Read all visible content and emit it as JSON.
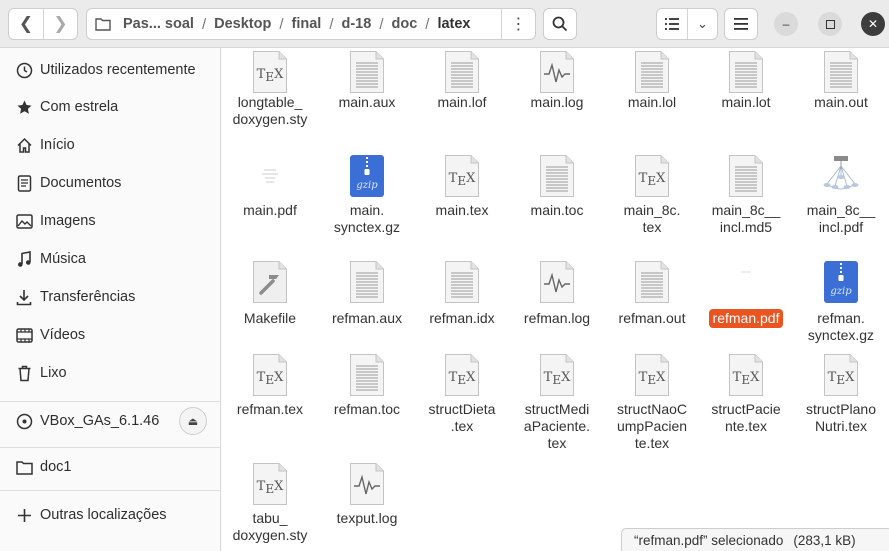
{
  "toolbar": {
    "back_icon": "chevron-left",
    "forward_icon": "chevron-right",
    "path": [
      "Pas... soal",
      "Desktop",
      "final",
      "d-18",
      "doc",
      "latex"
    ],
    "path_menu_icon": "vertical-dots",
    "search_icon": "magnifier",
    "view_icon": "list-view",
    "view_dropdown_icon": "chevron-down",
    "main_menu_icon": "hamburger",
    "minimize_icon": "minimize",
    "maximize_icon": "maximize",
    "close_icon": "close"
  },
  "sidebar": {
    "items": [
      {
        "label": "Utilizados recentemente",
        "icon": "clock"
      },
      {
        "label": "Com estrela",
        "icon": "star"
      },
      {
        "label": "Início",
        "icon": "home"
      },
      {
        "label": "Documentos",
        "icon": "document"
      },
      {
        "label": "Imagens",
        "icon": "image"
      },
      {
        "label": "Música",
        "icon": "music"
      },
      {
        "label": "Transferências",
        "icon": "download"
      },
      {
        "label": "Vídeos",
        "icon": "video"
      },
      {
        "label": "Lixo",
        "icon": "trash"
      }
    ],
    "devices": [
      {
        "label": "VBox_GAs_6.1.46",
        "icon": "disc"
      }
    ],
    "bookmarks": [
      {
        "label": "doc1",
        "icon": "folder"
      }
    ],
    "other": {
      "label": "Outras localizações",
      "icon": "plus"
    }
  },
  "files": [
    {
      "name": "longtable_\ndoxygen.sty",
      "type": "tex"
    },
    {
      "name": "main.aux",
      "type": "text"
    },
    {
      "name": "main.lof",
      "type": "text"
    },
    {
      "name": "main.log",
      "type": "log"
    },
    {
      "name": "main.lol",
      "type": "text"
    },
    {
      "name": "main.lot",
      "type": "text"
    },
    {
      "name": "main.out",
      "type": "text"
    },
    {
      "name": "main.pdf",
      "type": "pdf-thumb"
    },
    {
      "name": "main.\nsynctex.gz",
      "type": "gzip"
    },
    {
      "name": "main.tex",
      "type": "tex"
    },
    {
      "name": "main.toc",
      "type": "text"
    },
    {
      "name": "main_8c.\ntex",
      "type": "tex"
    },
    {
      "name": "main_8c__\nincl.md5",
      "type": "text"
    },
    {
      "name": "main_8c__\nincl.pdf",
      "type": "pdf-diagram"
    },
    {
      "name": "Makefile",
      "type": "make"
    },
    {
      "name": "refman.aux",
      "type": "text"
    },
    {
      "name": "refman.idx",
      "type": "text"
    },
    {
      "name": "refman.log",
      "type": "log"
    },
    {
      "name": "refman.out",
      "type": "text"
    },
    {
      "name": "refman.pdf",
      "type": "pdf-blank",
      "selected": true
    },
    {
      "name": "refman.\nsynctex.gz",
      "type": "gzip"
    },
    {
      "name": "refman.tex",
      "type": "tex"
    },
    {
      "name": "refman.toc",
      "type": "text"
    },
    {
      "name": "structDieta\n.tex",
      "type": "tex"
    },
    {
      "name": "structMedi\naPaciente.\ntex",
      "type": "tex"
    },
    {
      "name": "structNaoC\numpPacien\nte.tex",
      "type": "tex"
    },
    {
      "name": "structPacie\nnte.tex",
      "type": "tex"
    },
    {
      "name": "structPlano\nNutri.tex",
      "type": "tex"
    },
    {
      "name": "tabu_\ndoxygen.sty",
      "type": "tex"
    },
    {
      "name": "texput.log",
      "type": "log"
    }
  ],
  "status": {
    "text": "“refman.pdf” selecionado",
    "size": "(283,1 kB)"
  },
  "colors": {
    "accent": "#e95420",
    "gzip": "#3b6fd6"
  }
}
